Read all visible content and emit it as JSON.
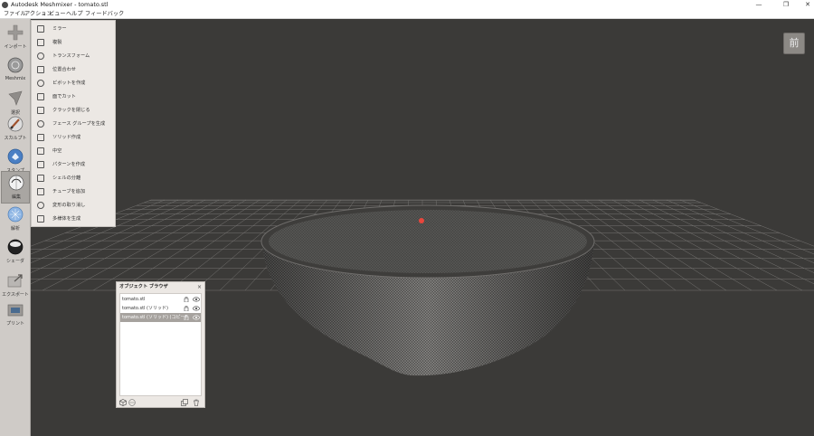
{
  "window": {
    "title": "Autodesk Meshmixer - tomato.stl",
    "minimize_glyph": "—",
    "restore_glyph": "❐",
    "close_glyph": "✕"
  },
  "menu": [
    "ファイル",
    "アクション",
    "ビュー",
    "ヘルプ",
    "フィードバック"
  ],
  "toolbar": [
    {
      "label": "インポート",
      "icon": "plus-icon"
    },
    {
      "label": "Meshmix",
      "icon": "meshmix-sphere-icon"
    },
    {
      "label": "選択",
      "icon": "select-arrow-icon"
    },
    {
      "label": "スカルプト",
      "icon": "brush-icon"
    },
    {
      "label": "スタンプ",
      "icon": "stamp-icon"
    },
    {
      "label": "編集",
      "icon": "edit-icon",
      "active": true
    },
    {
      "label": "解析",
      "icon": "analysis-icon"
    },
    {
      "label": "シェーダ",
      "icon": "shader-icon"
    },
    {
      "label": "エクスポート",
      "icon": "export-icon"
    },
    {
      "label": "プリント",
      "icon": "print-icon"
    }
  ],
  "edit_menu": [
    {
      "label": "ミラー",
      "icon": "mirror-icon"
    },
    {
      "label": "複製",
      "icon": "duplicate-icon"
    },
    {
      "label": "トランスフォーム",
      "icon": "transform-icon"
    },
    {
      "label": "位置合わせ",
      "icon": "align-icon"
    },
    {
      "label": "ピボットを作成",
      "icon": "pivot-icon"
    },
    {
      "label": "面でカット",
      "icon": "plane-cut-icon"
    },
    {
      "label": "クラックを閉じる",
      "icon": "close-cracks-icon"
    },
    {
      "label": "フェース グループを生成",
      "icon": "face-groups-icon"
    },
    {
      "label": "ソリッド作成",
      "icon": "make-solid-icon"
    },
    {
      "label": "中空",
      "icon": "hollow-icon"
    },
    {
      "label": "パターンを作成",
      "icon": "pattern-icon"
    },
    {
      "label": "シェルの分離",
      "icon": "separate-shells-icon"
    },
    {
      "label": "チューブを追加",
      "icon": "add-tube-icon"
    },
    {
      "label": "変形の取り消し",
      "icon": "undo-deform-icon"
    },
    {
      "label": "多様体を生成",
      "icon": "manifold-icon"
    }
  ],
  "viewcube": {
    "label": "前"
  },
  "object_browser": {
    "title": "オブジェクト ブラウザ",
    "close_glyph": "×",
    "items": [
      {
        "name": "tomato.stl",
        "selected": false
      },
      {
        "name": "tomato.stl (ソリッド)",
        "selected": false
      },
      {
        "name": "tomato.stl (ソリッド) (コピー)",
        "selected": true
      }
    ]
  },
  "colors": {
    "viewport_bg": "#3b3a38",
    "panel_bg": "#ece8e4",
    "toolbar_bg": "#cfcbc7",
    "selection": "#a6a29e",
    "pivot_marker": "#e8463c"
  }
}
